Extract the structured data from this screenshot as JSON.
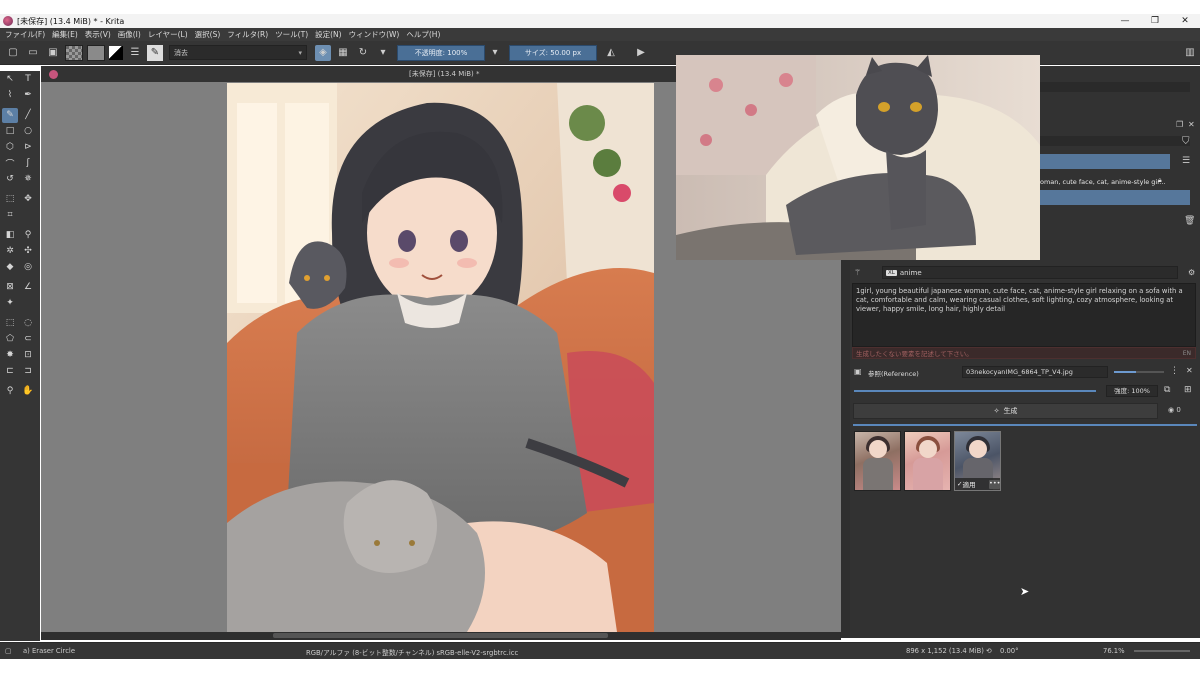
{
  "window": {
    "title": "[未保存]  (13.4 MiB) * - Krita",
    "minimize": "—",
    "maximize": "❐",
    "close": "✕"
  },
  "menu": [
    "ファイル(F)",
    "編集(E)",
    "表示(V)",
    "画像(I)",
    "レイヤー(L)",
    "選択(S)",
    "フィルタ(R)",
    "ツール(T)",
    "設定(N)",
    "ウィンドウ(W)",
    "ヘルプ(H)"
  ],
  "toolbar": {
    "blend_mode": "消去",
    "opacity": "不透明度: 100%",
    "size": "サイズ: 50.00 px"
  },
  "canvas": {
    "doc_title": "[未保存]  (13.4 MiB) *"
  },
  "layers": {
    "row_label": "oman, cute face, cat, anime-style gir..."
  },
  "ai_panel": {
    "style": "anime",
    "style_badge": "XL",
    "prompt": "1girl, young beautiful japanese woman, cute face, cat, anime-style girl relaxing on a sofa with a cat, comfortable and calm, wearing casual clothes, soft lighting, cozy atmosphere, looking at viewer, happy smile, long hair, highly detail",
    "negative_placeholder": "生成したくない要素を記述して下さい。",
    "negative_lang": "EN",
    "reference_mode": "参照(Reference)",
    "reference_file": "03nekocyanIMG_6864_TP_V4.jpg",
    "strength": "強度: 100%",
    "generate": "生成",
    "generate_count": "0",
    "apply_label": "適用",
    "more_label": "•••"
  },
  "status": {
    "brush": "a) Eraser Circle",
    "color_profile": "RGB/アルファ (8-ビット整数/チャンネル)  sRGB-elle-V2-srgbtrc.icc",
    "dimensions": "896 x 1,152 (13.4 MiB)",
    "rotation": "0.00°",
    "zoom": "76.1%"
  }
}
